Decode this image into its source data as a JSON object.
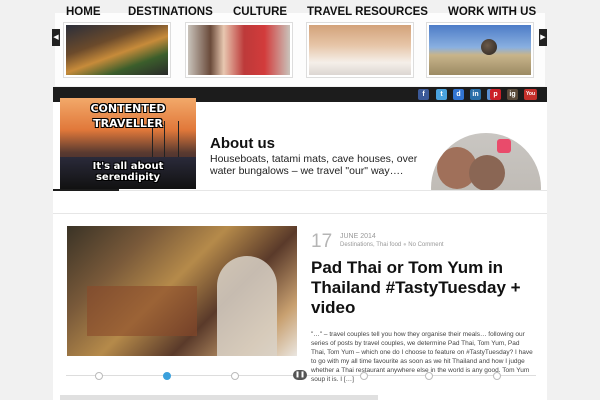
{
  "top_slider": {
    "prev_arrow": "◀",
    "next_arrow": "▶",
    "thumbnails": [
      "street-food-market",
      "couple-selfie",
      "woman-sunset",
      "outback-sphere"
    ]
  },
  "social": [
    {
      "icon": "facebook-icon",
      "label": "f",
      "color": "#3b5998"
    },
    {
      "icon": "twitter-icon",
      "label": "t",
      "color": "#4aa3df"
    },
    {
      "icon": "delicious-icon",
      "label": "d",
      "color": "#3274d1"
    },
    {
      "icon": "linkedin-icon",
      "label": "in",
      "color": "#2a6fa8"
    },
    {
      "icon": "rss-icon",
      "label": "r",
      "color": "#5a8fd0"
    },
    {
      "icon": "pinterest-icon",
      "label": "p",
      "color": "#cb2027"
    },
    {
      "icon": "instagram-icon",
      "label": "ig",
      "color": "#5a4a3a"
    },
    {
      "icon": "youtube-icon",
      "label": "You",
      "color": "#c4302b"
    }
  ],
  "logo": {
    "line1": "CONTENTED",
    "line2": "TRAVELLER",
    "tagline": "It's all about serendipity"
  },
  "about": {
    "title": "About us",
    "text": "Houseboats, tatami mats, cave houses, over water bungalows – we travel \"our\" way…."
  },
  "nav": [
    "HOME",
    "DESTINATIONS",
    "CULTURE",
    "TRAVEL RESOURCES",
    "WORK WITH US"
  ],
  "post": {
    "day": "17",
    "month": "JUNE 2014",
    "categories": "Destinations, Thai food",
    "comments": "No Comment",
    "title": "Pad Thai or Tom Yum in Thailand #TastyTuesday + video",
    "excerpt": "\"…\" – travel couples tell you how they organise their meals… following our series of posts by travel couples, we determine Pad Thai, Tom Yum, Pad Thai, Tom Yum – which one do I choose to feature on #TastyTuesday? I have to go with my all time favourite as soon as we hit Thailand and how I judge whether a Thai restaurant anywhere else in the world is any good. Tom Yum soup it is. I […]"
  },
  "slider_controls": {
    "pause": "❚❚",
    "active_index": 1,
    "count": 7
  }
}
